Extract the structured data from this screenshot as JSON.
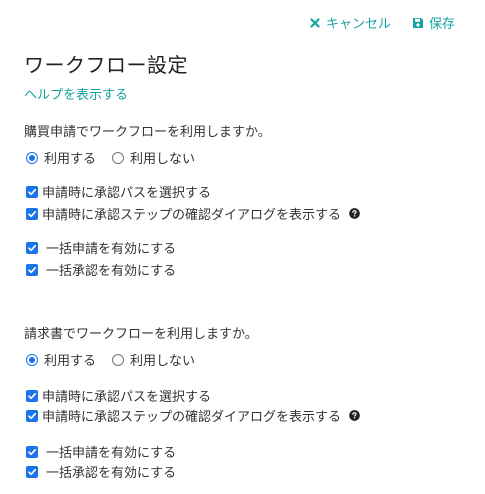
{
  "toolbar": {
    "cancel_label": "キャンセル",
    "save_label": "保存"
  },
  "page": {
    "title": "ワークフロー設定",
    "help_link": "ヘルプを表示する"
  },
  "sections": [
    {
      "question": "購買申請でワークフローを利用しますか。",
      "radio_use": "利用する",
      "radio_not_use": "利用しない",
      "selected": "利用する",
      "options": [
        {
          "label": "申請時に承認パスを選択する",
          "checked": true
        },
        {
          "label": "申請時に承認ステップの確認ダイアログを表示する",
          "checked": true
        }
      ],
      "bulk_options": [
        {
          "label": "一括申請を有効にする",
          "checked": true
        },
        {
          "label": "一括承認を有効にする",
          "checked": true
        }
      ]
    },
    {
      "question": "請求書でワークフローを利用しますか。",
      "radio_use": "利用する",
      "radio_not_use": "利用しない",
      "selected": "利用する",
      "options": [
        {
          "label": "申請時に承認パスを選択する",
          "checked": true
        },
        {
          "label": "申請時に承認ステップの確認ダイアログを表示する",
          "checked": true
        }
      ],
      "bulk_options": [
        {
          "label": "一括申請を有効にする",
          "checked": true
        },
        {
          "label": "一括承認を有効にする",
          "checked": true
        }
      ]
    }
  ],
  "icons": {
    "cancel": "close-icon",
    "save": "floppy-disk-icon",
    "help": "question-circle-icon"
  },
  "colors": {
    "accent": "#17a2a2",
    "control": "#1a73e8",
    "text": "#333333"
  }
}
